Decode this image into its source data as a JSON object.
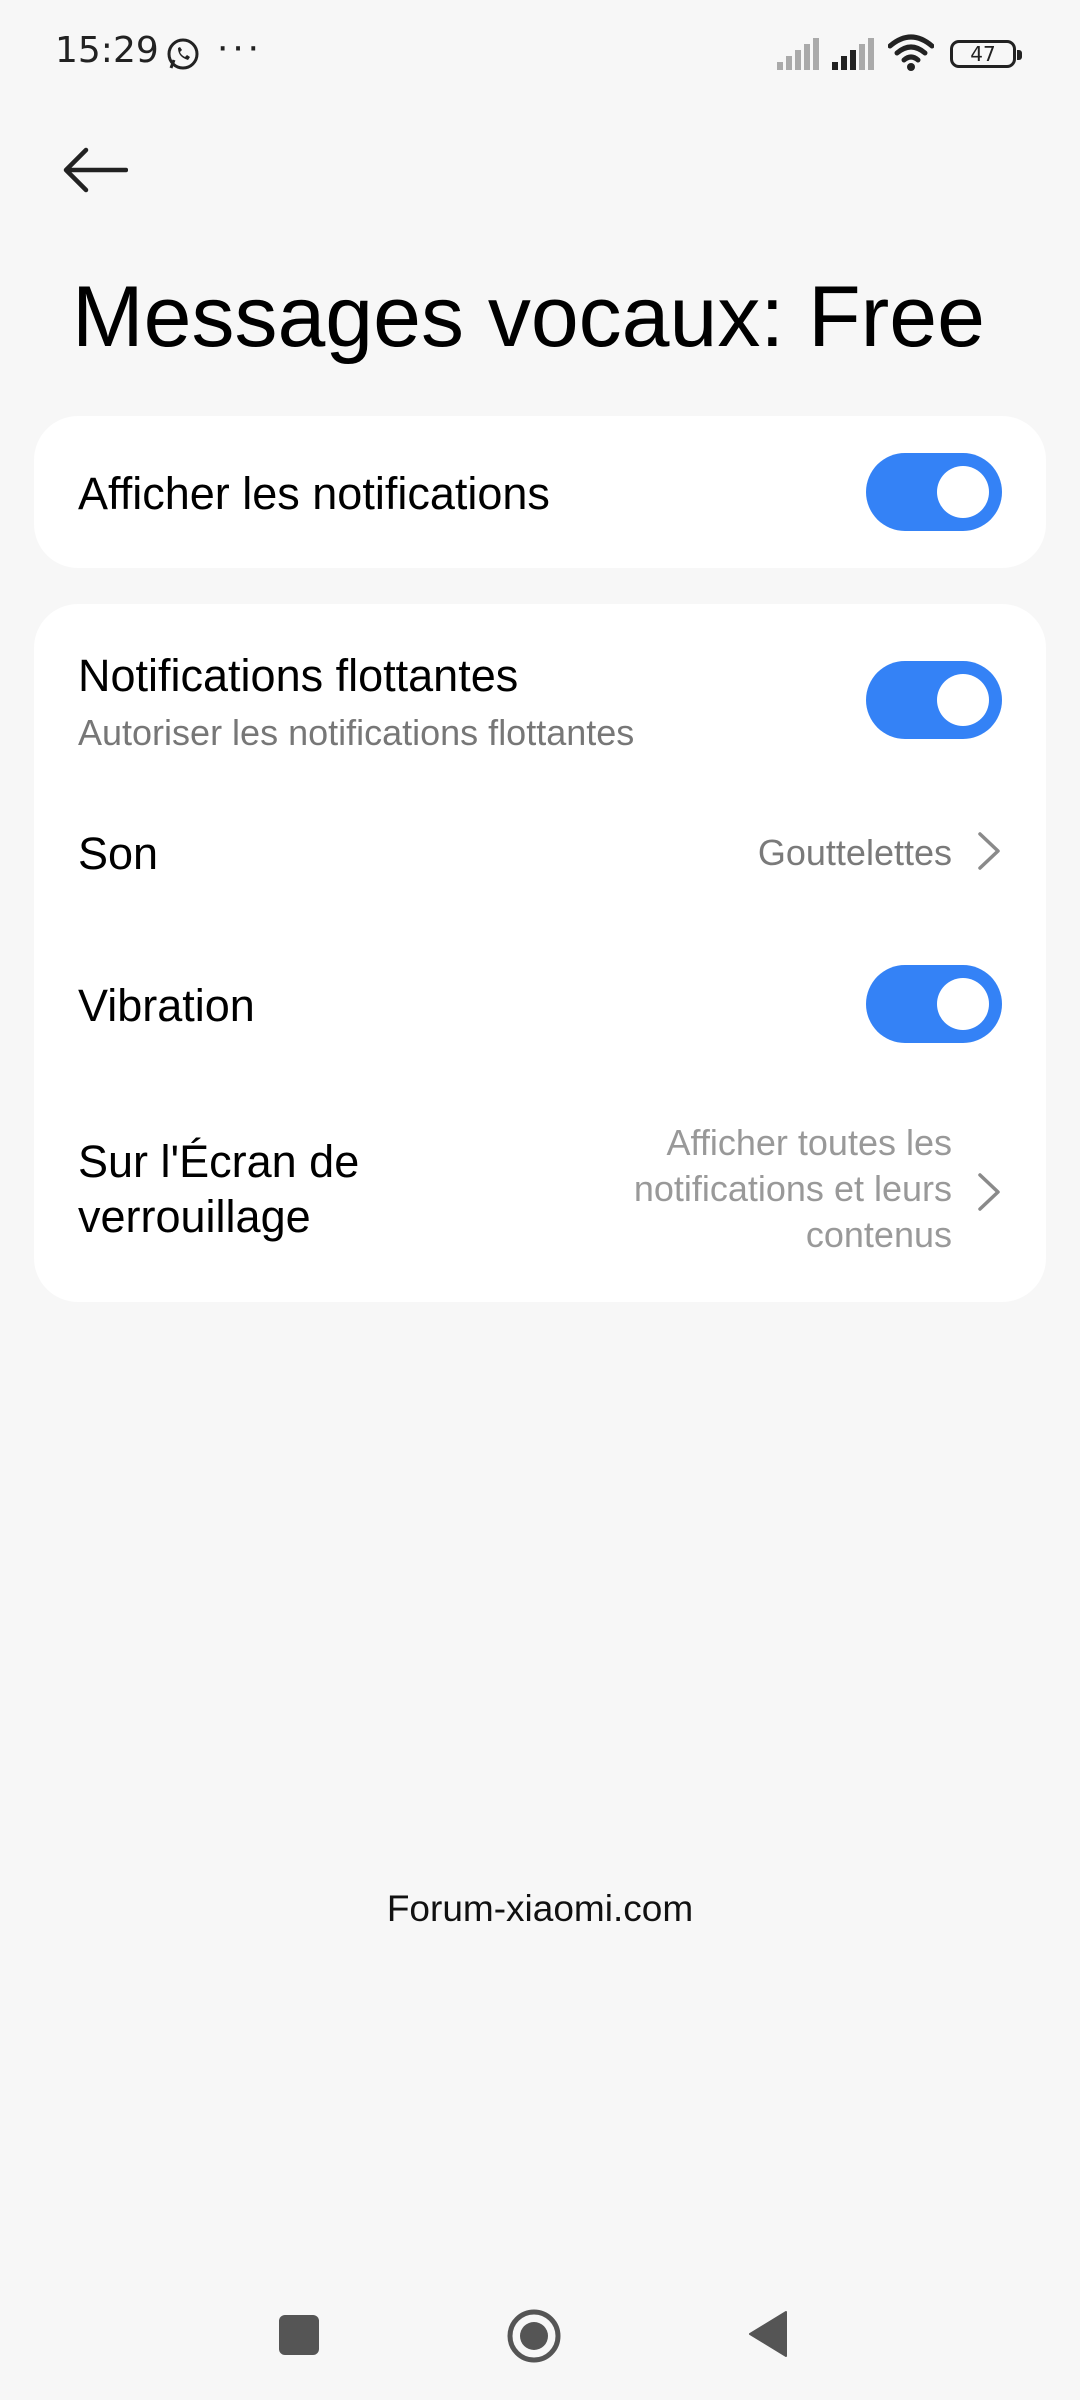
{
  "status_bar": {
    "time": "15:29",
    "overflow": "···",
    "battery_level": "47",
    "icons": [
      "whatsapp-icon",
      "signal-icon",
      "signal-icon",
      "wifi-icon",
      "battery-icon"
    ]
  },
  "header": {
    "back_icon": "arrow-left-icon",
    "title": "Messages vocaux: Free"
  },
  "card_main": {
    "show_notifications": {
      "label": "Afficher les notifications",
      "enabled": true
    }
  },
  "card_settings": {
    "floating": {
      "label": "Notifications flottantes",
      "subtitle": "Autoriser les notifications flottantes",
      "enabled": true
    },
    "sound": {
      "label": "Son",
      "value": "Gouttelettes"
    },
    "vibration": {
      "label": "Vibration",
      "enabled": true
    },
    "lockscreen": {
      "label_line1": "Sur l'Écran de",
      "label_line2": "verrouillage",
      "value_line1": "Afficher toutes les",
      "value_line2": "notifications et leurs",
      "value_line3": "contenus"
    }
  },
  "watermark": "Forum-xiaomi.com",
  "colors": {
    "accent": "#3482f6",
    "background": "#f7f7f7",
    "card": "#ffffff",
    "secondary_text": "#7a7a7a"
  },
  "nav_bar": {
    "icons": [
      "recents-square-icon",
      "home-circle-icon",
      "back-triangle-icon"
    ]
  }
}
